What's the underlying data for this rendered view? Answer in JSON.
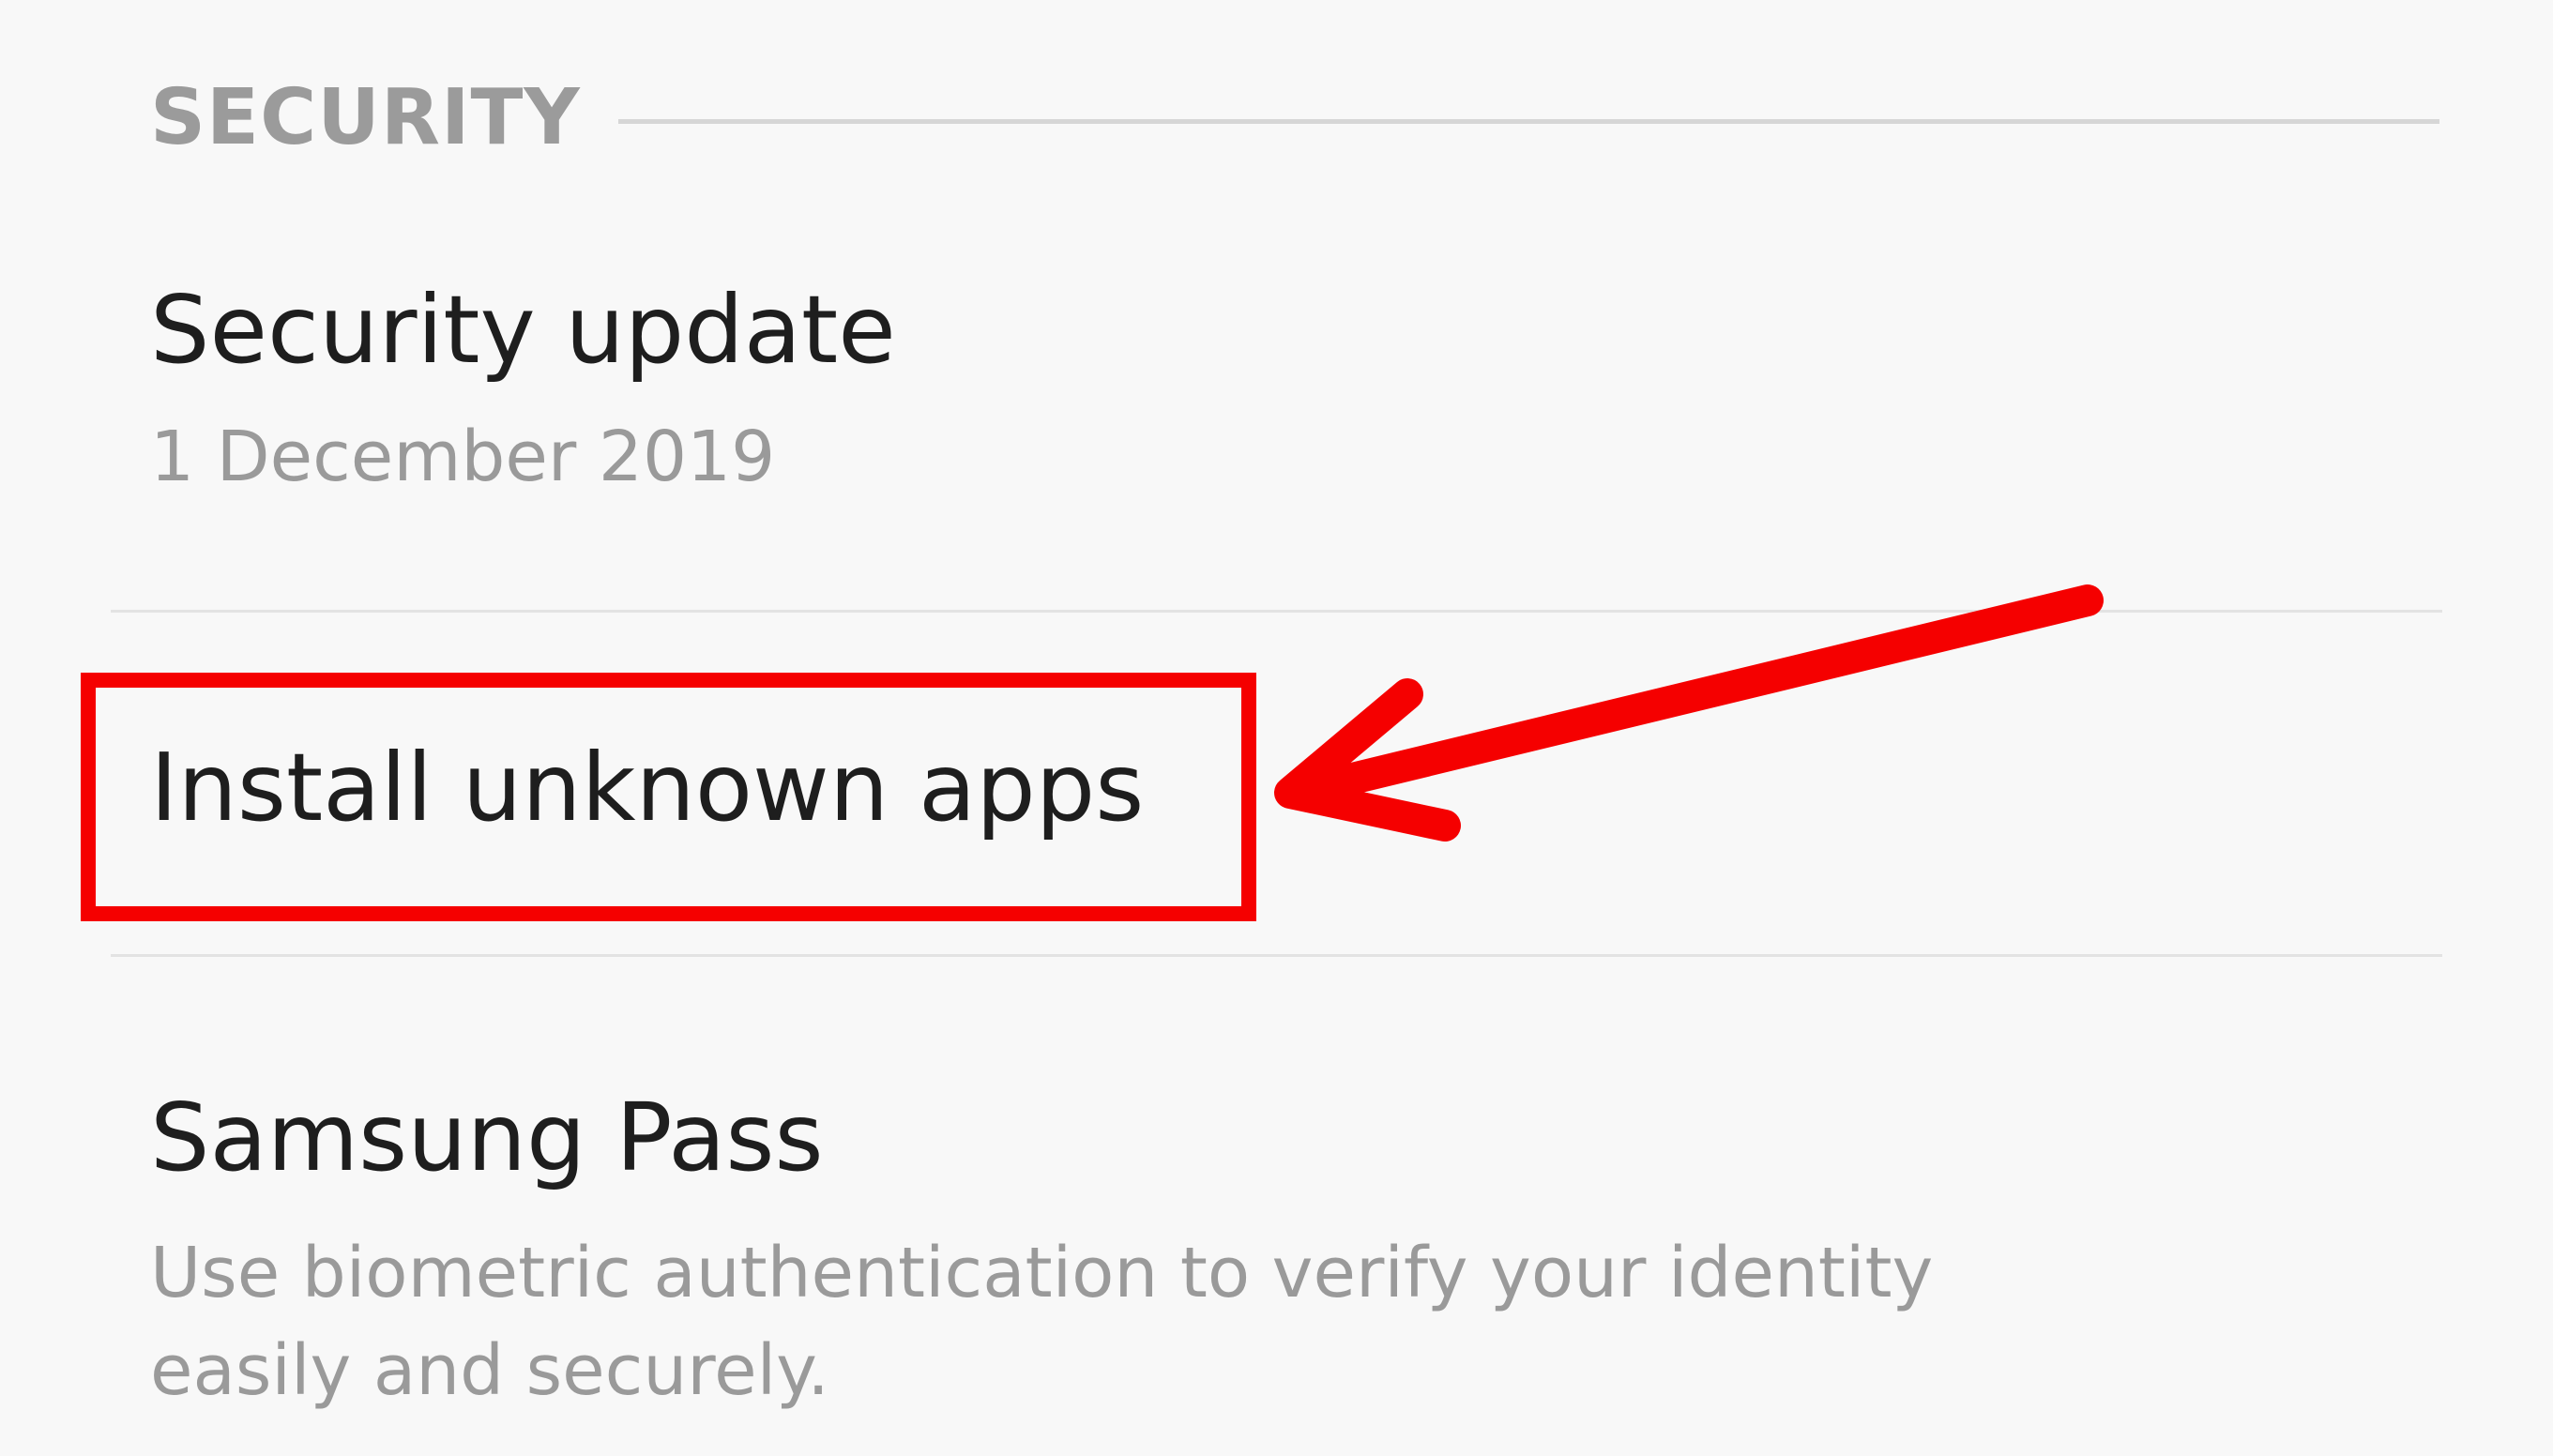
{
  "section": {
    "title": "SECURITY"
  },
  "items": [
    {
      "title": "Security update",
      "subtitle": "1 December 2019"
    },
    {
      "title": "Install unknown apps"
    },
    {
      "title": "Samsung Pass",
      "subtitle": "Use biometric authentication to verify your identity easily and securely."
    }
  ],
  "annotation": {
    "color": "#f50000",
    "target": "Install unknown apps"
  },
  "colors": {
    "background": "#f8f8f8",
    "title_text": "#1e1e1e",
    "secondary_text": "#9a9a9a"
  }
}
